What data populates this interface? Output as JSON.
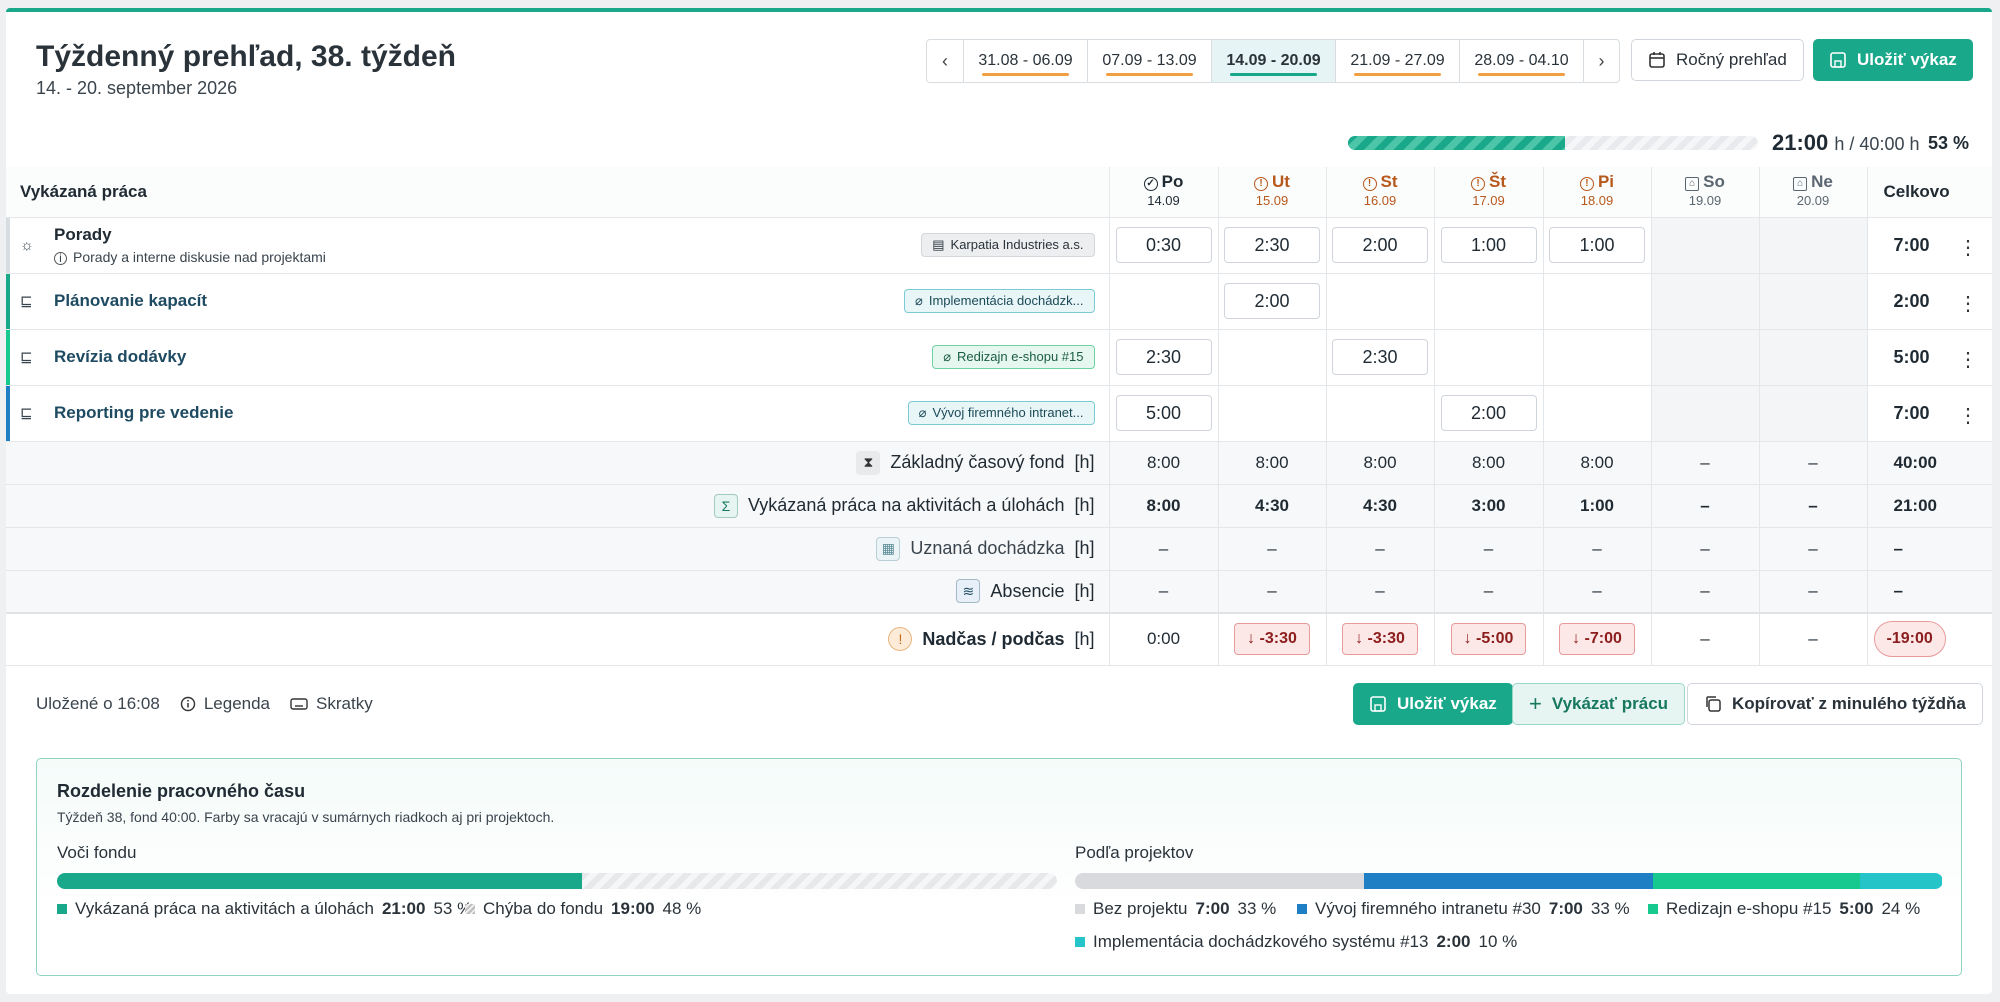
{
  "header": {
    "title": "Týždenný prehľad, 38. týždeň",
    "subtitle": "14. - 20. september 2026",
    "weeks": [
      "31.08 - 06.09",
      "07.09 - 13.09",
      "14.09 - 20.09",
      "21.09 - 27.09",
      "28.09 - 04.10"
    ],
    "active_week": "14.09 - 20.09",
    "prev": "‹",
    "next": "›",
    "btn_year": "Ročný prehľad",
    "btn_save": "Uložiť výkaz"
  },
  "progress": {
    "done": "21:00",
    "unit": "h / 40:00 h",
    "percent": "53 %",
    "fraction": 0.53
  },
  "table": {
    "col_task": "Vykázaná práca",
    "col_total": "Celkovo",
    "days": [
      {
        "name": "Po",
        "date": "14.09",
        "status": "ok"
      },
      {
        "name": "Ut",
        "date": "15.09",
        "status": "warn"
      },
      {
        "name": "St",
        "date": "16.09",
        "status": "warn"
      },
      {
        "name": "Št",
        "date": "17.09",
        "status": "warn"
      },
      {
        "name": "Pi",
        "date": "18.09",
        "status": "warn"
      },
      {
        "name": "So",
        "date": "19.09",
        "status": "weekend"
      },
      {
        "name": "Ne",
        "date": "20.09",
        "status": "weekend"
      }
    ],
    "rows": [
      {
        "name": "Porady",
        "sub": "Porady a interne diskusie nad projektami",
        "tag": "Karpatia Industries a.s.",
        "values": [
          "0:30",
          "2:30",
          "2:00",
          "1:00",
          "1:00",
          "",
          ""
        ],
        "total": "7:00"
      },
      {
        "name": "Plánovanie kapacít",
        "tag": "Implementácia dochádzk...",
        "values": [
          "",
          "2:00",
          "",
          "",
          "",
          "",
          ""
        ],
        "total": "2:00"
      },
      {
        "name": "Revízia dodávky",
        "tag": "Redizajn e-shopu #15",
        "values": [
          "2:30",
          "",
          "2:30",
          "",
          "",
          "",
          ""
        ],
        "total": "5:00"
      },
      {
        "name": "Reporting pre vedenie",
        "tag": "Vývoj firemného intranet...",
        "values": [
          "5:00",
          "",
          "",
          "2:00",
          "",
          "",
          ""
        ],
        "total": "7:00"
      }
    ],
    "summary": [
      {
        "label": "Základný časový fond",
        "unit": "[h]",
        "values": [
          "8:00",
          "8:00",
          "8:00",
          "8:00",
          "8:00",
          "–",
          "–"
        ],
        "total": "40:00"
      },
      {
        "label": "Vykázaná práca na aktivitách a úlohách",
        "unit": "[h]",
        "values": [
          "8:00",
          "4:30",
          "4:30",
          "3:00",
          "1:00",
          "–",
          "–"
        ],
        "total": "21:00"
      },
      {
        "label": "Uznaná dochádzka",
        "unit": "[h]",
        "values": [
          "–",
          "–",
          "–",
          "–",
          "–",
          "–",
          "–"
        ],
        "total": "–"
      },
      {
        "label": "Absencie",
        "unit": "[h]",
        "values": [
          "–",
          "–",
          "–",
          "–",
          "–",
          "–",
          "–"
        ],
        "total": "–"
      }
    ],
    "overtime": {
      "label": "Nadčas / podčas",
      "unit": "[h]",
      "values": [
        "0:00",
        "-3:30",
        "-3:30",
        "-5:00",
        "-7:00",
        "–",
        "–"
      ],
      "total": "-19:00"
    }
  },
  "footer": {
    "saved": "Uložené o 16:08",
    "legend": "Legenda",
    "shortcuts": "Skratky",
    "btn_save": "Uložiť výkaz",
    "btn_log": "Vykázať prácu",
    "btn_copy": "Kopírovať z minulého týždňa"
  },
  "distribution": {
    "title": "Rozdelenie pracovného času",
    "subtitle": "Týždeň 38, fond 40:00. Farby sa vracajú v sumárnych riadkoch aj pri projektoch.",
    "fund_heading": "Voči fondu",
    "project_heading": "Podľa projektov",
    "fund_items": [
      {
        "label": "Vykázaná práca na aktivitách a úlohách",
        "time": "21:00",
        "pct": "53 %",
        "fraction": 0.525,
        "color": "#1aa88a"
      },
      {
        "label": "Chýba do fondu",
        "time": "19:00",
        "pct": "48 %",
        "fraction": 0.475,
        "color": "#e6e8ea"
      }
    ],
    "project_items": [
      {
        "label": "Bez projektu",
        "time": "7:00",
        "pct": "33 %",
        "fraction": 0.333,
        "color": "#d8dadd"
      },
      {
        "label": "Vývoj firemného intranetu #30",
        "time": "7:00",
        "pct": "33 %",
        "fraction": 0.333,
        "color": "#1f7fc4"
      },
      {
        "label": "Redizajn e-shopu #15",
        "time": "5:00",
        "pct": "24 %",
        "fraction": 0.238,
        "color": "#17c98f"
      },
      {
        "label": "Implementácia dochádzkového systému #13",
        "time": "2:00",
        "pct": "10 %",
        "fraction": 0.095,
        "color": "#25c4c9"
      }
    ]
  }
}
